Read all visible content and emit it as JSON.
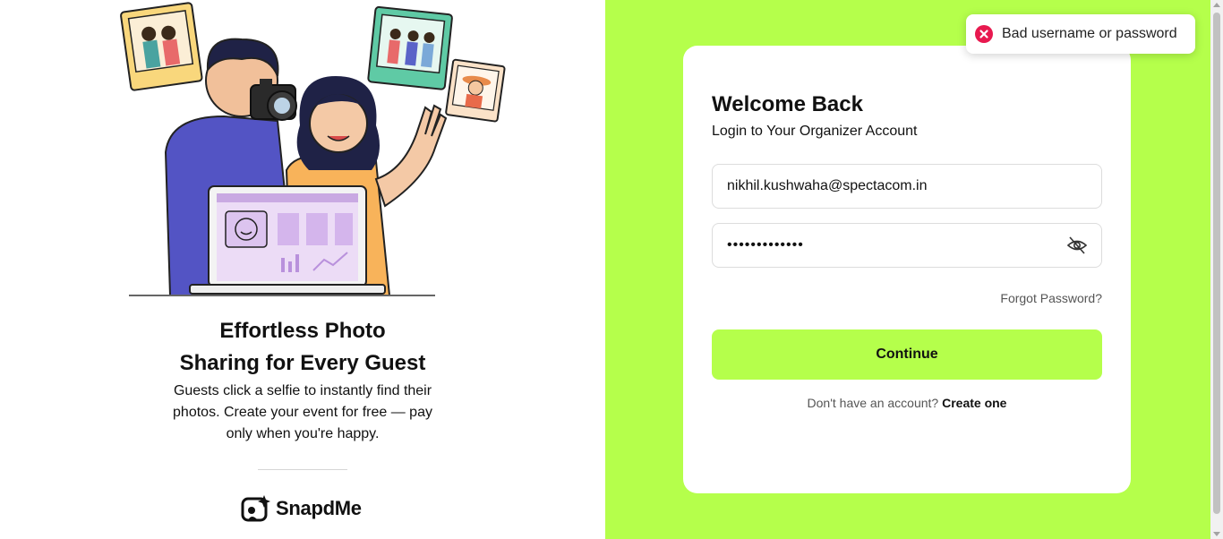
{
  "left": {
    "tagline_line1": "Effortless Photo",
    "tagline_line2": "Sharing for Every Guest",
    "subtext": "Guests click a selfie to instantly find their photos. Create your event for free — pay only when you're happy.",
    "brand_name": "SnapdMe",
    "hero_illustration": "photographer-couple-with-laptop-and-photos"
  },
  "login": {
    "title": "Welcome Back",
    "subtitle": "Login to Your Organizer Account",
    "email_value": "nikhil.kushwaha@spectacom.in",
    "password_value": "•••••••••••••",
    "forgot_label": "Forgot Password?",
    "continue_label": "Continue",
    "signup_prompt": "Don't have an account?",
    "signup_link": "Create one"
  },
  "toast": {
    "message": "Bad username or password",
    "icon": "error-x-icon",
    "color": "#e8194f"
  },
  "colors": {
    "accent": "#b5ff4b",
    "card": "#ffffff"
  }
}
